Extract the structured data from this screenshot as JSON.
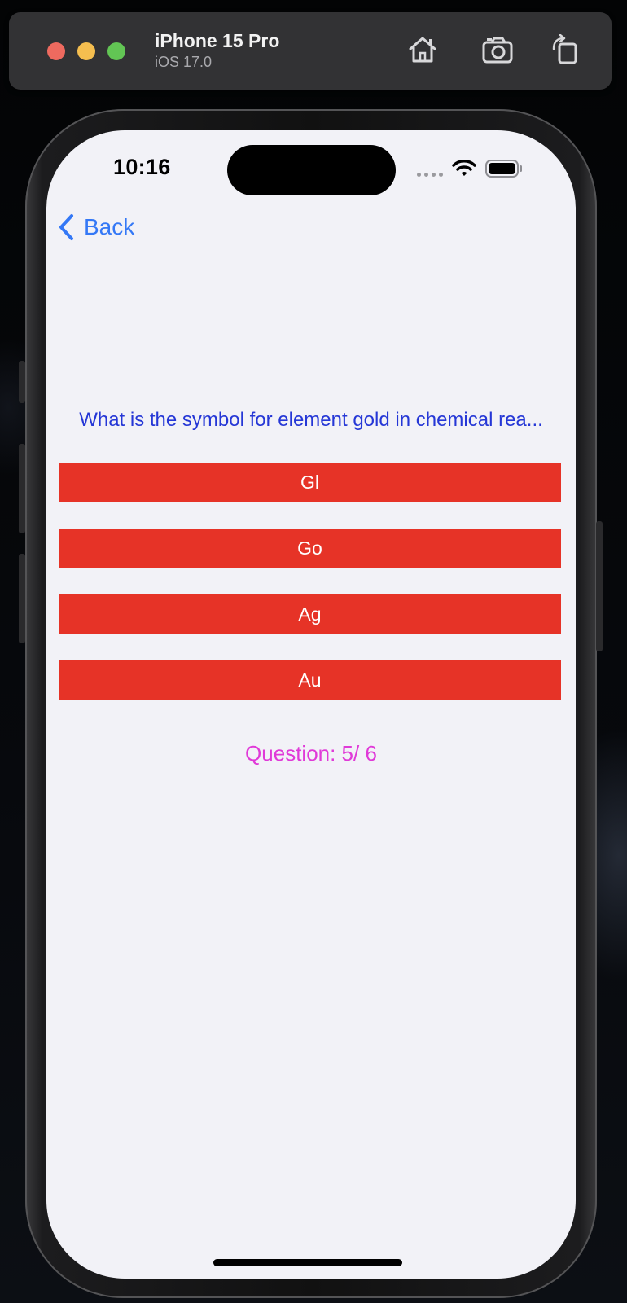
{
  "simulator": {
    "device_name": "iPhone 15 Pro",
    "os_version": "iOS 17.0",
    "tools": [
      {
        "name": "home",
        "icon": "home-icon"
      },
      {
        "name": "screenshot",
        "icon": "camera-icon"
      },
      {
        "name": "rotate",
        "icon": "rotate-icon"
      }
    ]
  },
  "status_bar": {
    "time": "10:16"
  },
  "nav": {
    "back_label": "Back"
  },
  "quiz": {
    "question": "What is the symbol for element gold in chemical rea...",
    "answers": [
      "Gl",
      "Go",
      "Ag",
      "Au"
    ],
    "progress_text": "Question: 5/ 6"
  },
  "colors": {
    "accent_blue": "#3478f6",
    "question_blue": "#2537d6",
    "answer_red": "#e63327",
    "progress_magenta": "#e03ad8",
    "screen_bg": "#f2f2f7"
  }
}
